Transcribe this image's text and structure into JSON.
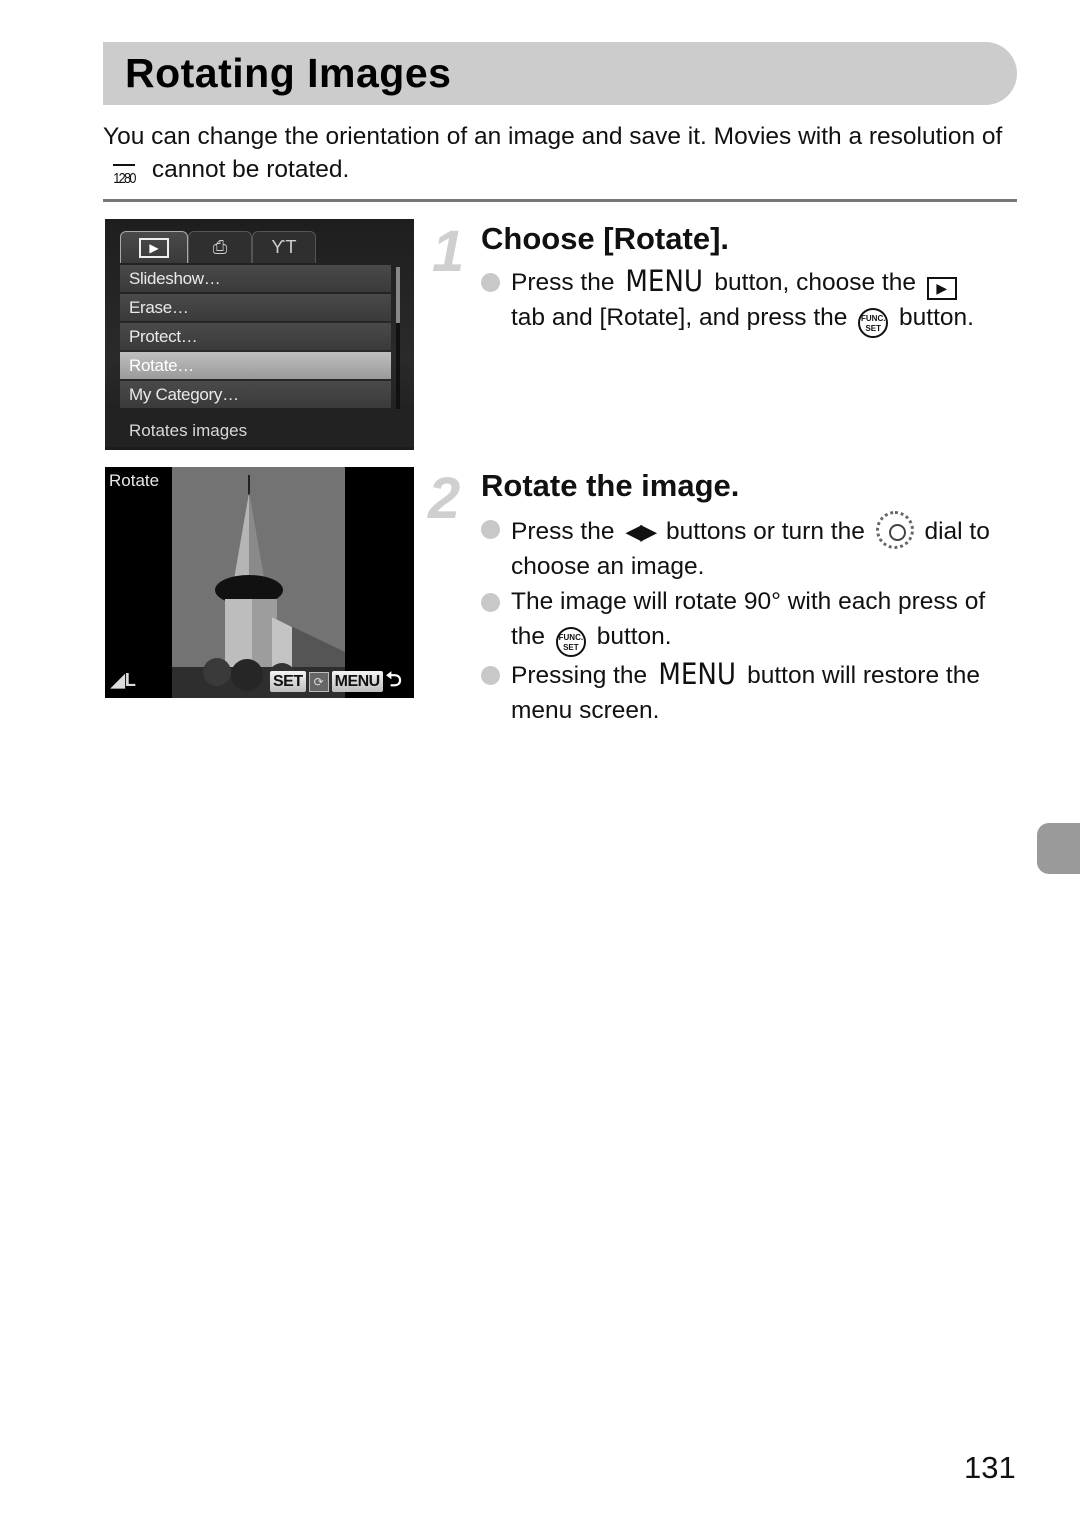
{
  "page": {
    "title": "Rotating Images",
    "intro": {
      "part1": "You can change the orientation of an image and save it. Movies with a resolution of",
      "resolution_icon": "1280",
      "part2": "cannot be rotated."
    },
    "page_number": "131"
  },
  "camera_menu": {
    "tabs": [
      {
        "icon": "playback-tab-icon",
        "glyph": "▶",
        "active": true
      },
      {
        "icon": "print-tab-icon",
        "glyph": "⎙",
        "active": false
      },
      {
        "icon": "settings-tab-icon",
        "glyph": "ƳT",
        "active": false
      }
    ],
    "items": [
      {
        "label": "Slideshow…",
        "selected": false
      },
      {
        "label": "Erase…",
        "selected": false
      },
      {
        "label": "Protect…",
        "selected": false
      },
      {
        "label": "Rotate…",
        "selected": true
      },
      {
        "label": "My Category…",
        "selected": false
      }
    ],
    "hint": "Rotates images"
  },
  "camera_rotate": {
    "label": "Rotate",
    "size_badge": "◢L",
    "set_label": "SET",
    "rotate_icon": "⟳",
    "menu_label": "MENU",
    "back_icon": "⮌"
  },
  "steps": [
    {
      "number": "1",
      "title": "Choose [Rotate].",
      "bullets": [
        {
          "t1": "Press the",
          "menu": "MENU",
          "t2": "button, choose the",
          "play": "▶",
          "t3": "tab and [Rotate], and press the",
          "func_top": "FUNC.",
          "func_bot": "SET",
          "t4": "button."
        }
      ]
    },
    {
      "number": "2",
      "title": "Rotate the image.",
      "bullets": [
        {
          "t1": "Press the",
          "lr": "◀▶",
          "t2": "buttons or turn the",
          "t3": "dial to choose an image."
        },
        {
          "t1": "The image will rotate 90° with each press of the",
          "func_top": "FUNC.",
          "func_bot": "SET",
          "t2": "button."
        },
        {
          "t1": "Pressing the",
          "menu": "MENU",
          "t2": "button will restore the menu screen."
        }
      ]
    }
  ]
}
